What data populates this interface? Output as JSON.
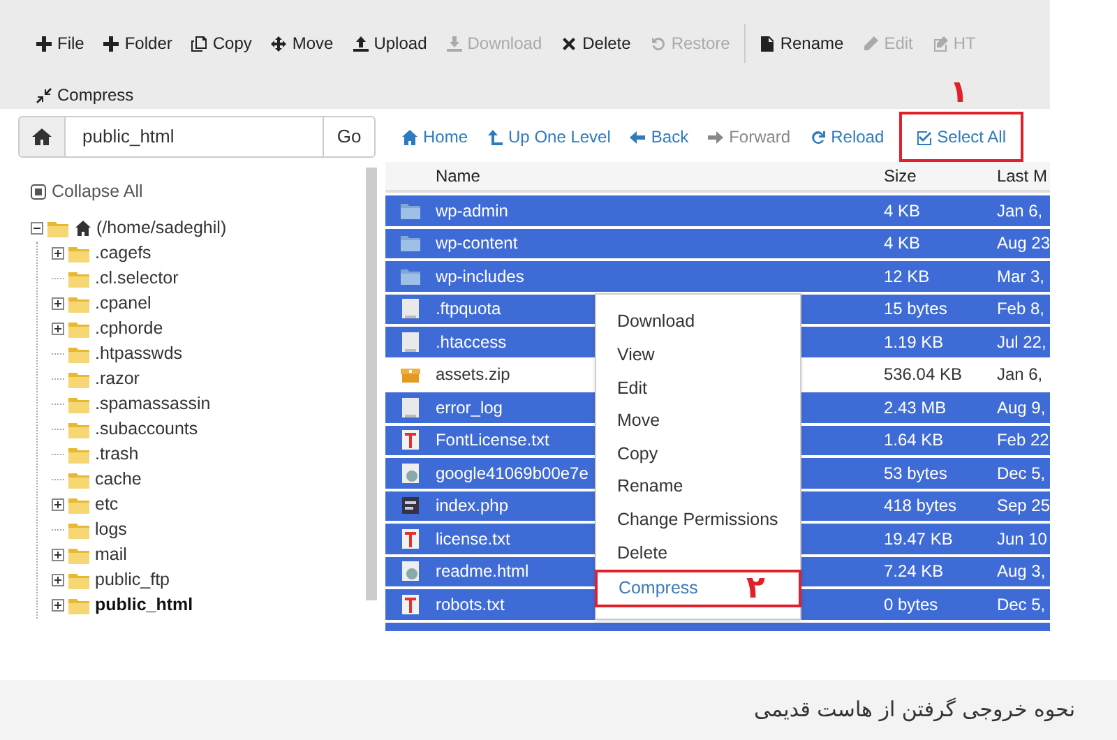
{
  "toolbar": [
    {
      "label": "File",
      "disabled": false
    },
    {
      "label": "Folder",
      "disabled": false
    },
    {
      "label": "Copy",
      "disabled": false
    },
    {
      "label": "Move",
      "disabled": false
    },
    {
      "label": "Upload",
      "disabled": false
    },
    {
      "label": "Download",
      "disabled": true
    },
    {
      "label": "Delete",
      "disabled": false
    },
    {
      "label": "Restore",
      "disabled": true
    },
    {
      "label": "Rename",
      "disabled": false
    },
    {
      "label": "Edit",
      "disabled": true
    },
    {
      "label": "HT",
      "disabled": true
    },
    {
      "label": "Compress",
      "disabled": false
    }
  ],
  "path_field": {
    "value": "public_html",
    "button": "Go"
  },
  "nav": [
    {
      "label": "Home",
      "disabled": false,
      "highlighted": false
    },
    {
      "label": "Up One Level",
      "disabled": false,
      "highlighted": false
    },
    {
      "label": "Back",
      "disabled": false,
      "highlighted": false
    },
    {
      "label": "Forward",
      "disabled": true,
      "highlighted": false
    },
    {
      "label": "Reload",
      "disabled": false,
      "highlighted": false
    },
    {
      "label": "Select All",
      "disabled": false,
      "highlighted": true,
      "annotation": "۱"
    }
  ],
  "tree": {
    "collapse_label": "Collapse All",
    "root": {
      "label": "(/home/sadeghil)",
      "expanded": true,
      "children": [
        {
          "label": ".cagefs",
          "has_children": true,
          "selected": false
        },
        {
          "label": ".cl.selector",
          "has_children": false,
          "selected": false
        },
        {
          "label": ".cpanel",
          "has_children": true,
          "selected": false
        },
        {
          "label": ".cphorde",
          "has_children": true,
          "selected": false
        },
        {
          "label": ".htpasswds",
          "has_children": false,
          "selected": false
        },
        {
          "label": ".razor",
          "has_children": false,
          "selected": false
        },
        {
          "label": ".spamassassin",
          "has_children": false,
          "selected": false
        },
        {
          "label": ".subaccounts",
          "has_children": false,
          "selected": false
        },
        {
          "label": ".trash",
          "has_children": false,
          "selected": false
        },
        {
          "label": "cache",
          "has_children": false,
          "selected": false
        },
        {
          "label": "etc",
          "has_children": true,
          "selected": false
        },
        {
          "label": "logs",
          "has_children": false,
          "selected": false
        },
        {
          "label": "mail",
          "has_children": true,
          "selected": false
        },
        {
          "label": "public_ftp",
          "has_children": true,
          "selected": false
        },
        {
          "label": "public_html",
          "has_children": true,
          "selected": true
        }
      ]
    }
  },
  "table": {
    "columns": [
      "Name",
      "Size",
      "Last M"
    ],
    "rows": [
      {
        "kind": "folder",
        "name": "wp-admin",
        "size": "4 KB",
        "modified": "Jan 6,",
        "selected": true
      },
      {
        "kind": "folder",
        "name": "wp-content",
        "size": "4 KB",
        "modified": "Aug 23",
        "selected": true
      },
      {
        "kind": "folder",
        "name": "wp-includes",
        "size": "12 KB",
        "modified": "Mar 3,",
        "selected": true
      },
      {
        "kind": "file",
        "name": ".ftpquota",
        "size": "15 bytes",
        "modified": "Feb 8,",
        "selected": true
      },
      {
        "kind": "file",
        "name": ".htaccess",
        "size": "1.19 KB",
        "modified": "Jul 22,",
        "selected": true
      },
      {
        "kind": "zip",
        "name": "assets.zip",
        "size": "536.04 KB",
        "modified": "Jan 6,",
        "selected": false
      },
      {
        "kind": "file",
        "name": "error_log",
        "size": "2.43 MB",
        "modified": "Aug 9,",
        "selected": true
      },
      {
        "kind": "text",
        "name": "FontLicense.txt",
        "size": "1.64 KB",
        "modified": "Feb 22",
        "selected": true
      },
      {
        "kind": "html",
        "name": "google41069b00e7e",
        "size": "53 bytes",
        "modified": "Dec 5,",
        "selected": true
      },
      {
        "kind": "php",
        "name": "index.php",
        "size": "418 bytes",
        "modified": "Sep 25",
        "selected": true
      },
      {
        "kind": "text",
        "name": "license.txt",
        "size": "19.47 KB",
        "modified": "Jun 10",
        "selected": true
      },
      {
        "kind": "html",
        "name": "readme.html",
        "size": "7.24 KB",
        "modified": "Aug 3,",
        "selected": true
      },
      {
        "kind": "text",
        "name": "robots.txt",
        "size": "0 bytes",
        "modified": "Dec 5,",
        "selected": true
      }
    ]
  },
  "context_menu": {
    "items": [
      {
        "label": "Download",
        "selected": false
      },
      {
        "label": "View",
        "selected": false
      },
      {
        "label": "Edit",
        "selected": false
      },
      {
        "label": "Move",
        "selected": false
      },
      {
        "label": "Copy",
        "selected": false
      },
      {
        "label": "Rename",
        "selected": false
      },
      {
        "label": "Change Permissions",
        "selected": false
      },
      {
        "label": "Delete",
        "selected": false
      },
      {
        "label": "Compress",
        "selected": true,
        "annotation": "۲"
      }
    ]
  },
  "caption": "نحوه خروجی گرفتن از هاست قدیمی"
}
